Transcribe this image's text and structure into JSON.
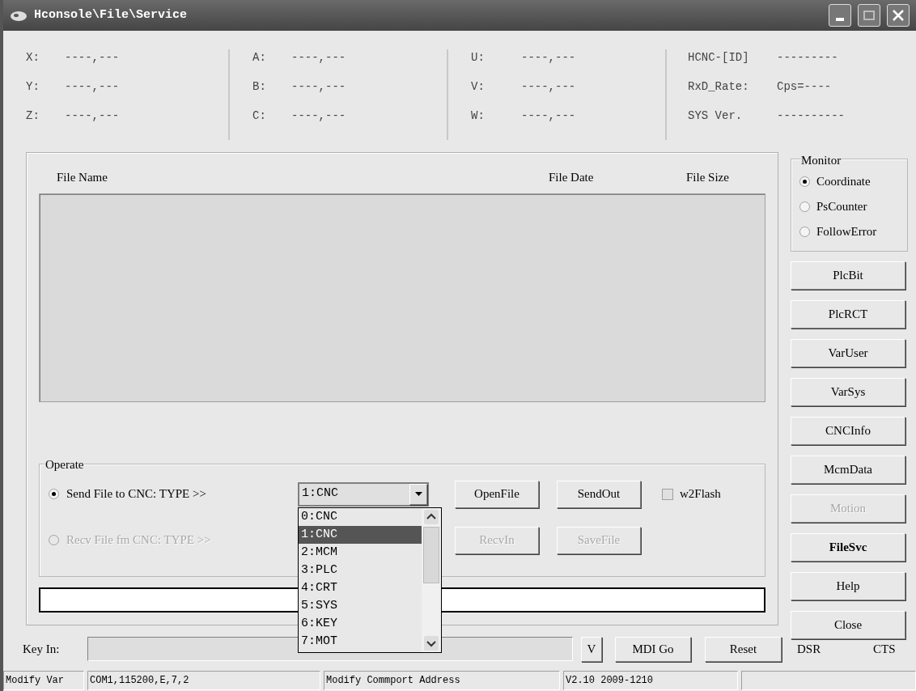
{
  "window": {
    "title": "Hconsole\\File\\Service"
  },
  "readouts": [
    {
      "rows": [
        {
          "label": "X:",
          "value": "----,---"
        },
        {
          "label": "Y:",
          "value": "----,---"
        },
        {
          "label": "Z:",
          "value": "----,---"
        }
      ]
    },
    {
      "rows": [
        {
          "label": "A:",
          "value": "----,---"
        },
        {
          "label": "B:",
          "value": "----,---"
        },
        {
          "label": "C:",
          "value": "----,---"
        }
      ]
    },
    {
      "rows": [
        {
          "label": "U:",
          "value": "----,---"
        },
        {
          "label": "V:",
          "value": "----,---"
        },
        {
          "label": "W:",
          "value": "----,---"
        }
      ]
    },
    {
      "rows": [
        {
          "label": "HCNC-[ID]",
          "value": "---------"
        },
        {
          "label": "RxD_Rate:",
          "value": "Cps=----"
        },
        {
          "label": "SYS Ver.",
          "value": "----------"
        }
      ]
    }
  ],
  "file_list": {
    "columns": [
      "File Name",
      "File Date",
      "File Size"
    ]
  },
  "operate": {
    "title": "Operate",
    "modes": [
      {
        "label": "Send File to CNC:  TYPE >>",
        "selected": true,
        "disabled": false
      },
      {
        "label": "Recv File fm CNC:  TYPE >>",
        "selected": false,
        "disabled": true
      }
    ],
    "type_combo": {
      "value": "1:CNC",
      "expanded": true,
      "options": [
        {
          "label": "0:CNC",
          "selected": false
        },
        {
          "label": "1:CNC",
          "selected": true
        },
        {
          "label": "2:MCM",
          "selected": false
        },
        {
          "label": "3:PLC",
          "selected": false
        },
        {
          "label": "4:CRT",
          "selected": false
        },
        {
          "label": "5:SYS",
          "selected": false
        },
        {
          "label": "6:KEY",
          "selected": false
        },
        {
          "label": "7:MOT",
          "selected": false
        }
      ]
    },
    "buttons": [
      [
        {
          "label": "OpenFile",
          "disabled": false
        },
        {
          "label": "SendOut",
          "disabled": false
        }
      ],
      [
        {
          "label": "RecvIn",
          "disabled": true
        },
        {
          "label": "SaveFile",
          "disabled": true
        }
      ]
    ],
    "w2flash": {
      "label": "w2Flash",
      "checked": false
    }
  },
  "monitor": {
    "title": "Monitor",
    "options": [
      {
        "label": "Coordinate",
        "selected": true
      },
      {
        "label": "PsCounter",
        "selected": false
      },
      {
        "label": "FollowError",
        "selected": false
      }
    ]
  },
  "side_buttons": [
    {
      "label": "PlcBit",
      "selected": false,
      "disabled": false
    },
    {
      "label": "PlcRCT",
      "selected": false,
      "disabled": false
    },
    {
      "label": "VarUser",
      "selected": false,
      "disabled": false
    },
    {
      "label": "VarSys",
      "selected": false,
      "disabled": false
    },
    {
      "label": "CNCInfo",
      "selected": false,
      "disabled": false
    },
    {
      "label": "McmData",
      "selected": false,
      "disabled": false
    },
    {
      "label": "Motion",
      "selected": false,
      "disabled": true
    },
    {
      "label": "FileSvc",
      "selected": true,
      "disabled": false
    },
    {
      "label": "Help",
      "selected": false,
      "disabled": false
    },
    {
      "label": "Close",
      "selected": false,
      "disabled": false
    }
  ],
  "key_in": {
    "label": "Key In:",
    "buttons": [
      "V",
      "MDI Go",
      "Reset"
    ]
  },
  "signals": [
    "DSR",
    "CTS"
  ],
  "status_bar": [
    "Modify Var",
    "COM1,115200,E,7,2",
    "Modify Commport Address",
    "V2.10 2009-1210"
  ]
}
